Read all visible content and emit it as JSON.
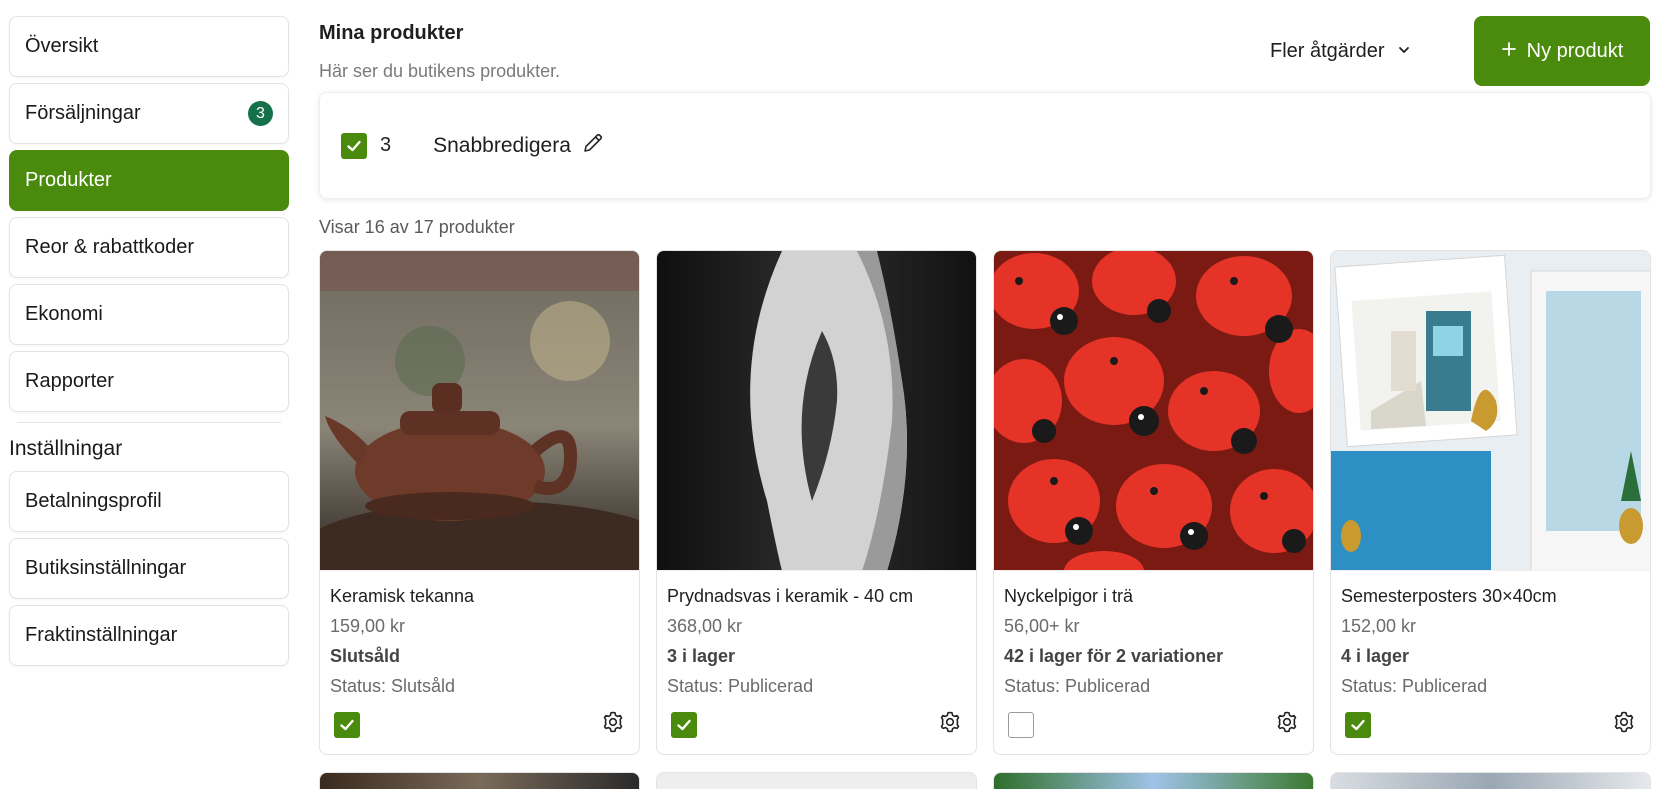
{
  "sidebar": {
    "items": [
      {
        "label": "Översikt"
      },
      {
        "label": "Försäljningar",
        "badge": "3"
      },
      {
        "label": "Produkter",
        "active": true
      },
      {
        "label": "Reor & rabattkoder"
      },
      {
        "label": "Ekonomi"
      },
      {
        "label": "Rapporter"
      }
    ],
    "settings_title": "Inställningar",
    "settings_items": [
      {
        "label": "Betalningsprofil"
      },
      {
        "label": "Butiksinställningar"
      },
      {
        "label": "Fraktinställningar"
      }
    ]
  },
  "header": {
    "title": "Mina produkter",
    "subtitle": "Här ser du butikens produkter.",
    "more_actions": "Fler åtgärder",
    "new_product": "Ny produkt"
  },
  "bulk": {
    "selected_count": "3",
    "quick_edit": "Snabbredigera"
  },
  "showing": "Visar 16 av 17 produkter",
  "products": [
    {
      "name": "Keramisk tekanna",
      "price": "159,00 kr",
      "stock": "Slutsåld",
      "status": "Status: Slutsåld",
      "checked": true
    },
    {
      "name": "Prydnadsvas i keramik - 40 cm",
      "price": "368,00 kr",
      "stock": "3 i lager",
      "status": "Status: Publicerad",
      "checked": true
    },
    {
      "name": "Nyckelpigor i trä",
      "price": "56,00+ kr",
      "stock": "42 i lager för 2 variationer",
      "status": "Status: Publicerad",
      "checked": false
    },
    {
      "name": "Semesterposters 30×40cm",
      "price": "152,00 kr",
      "stock": "4 i lager",
      "status": "Status: Publicerad",
      "checked": true
    }
  ],
  "colors": {
    "brand": "#4a8a0d",
    "badge": "#16714b"
  }
}
